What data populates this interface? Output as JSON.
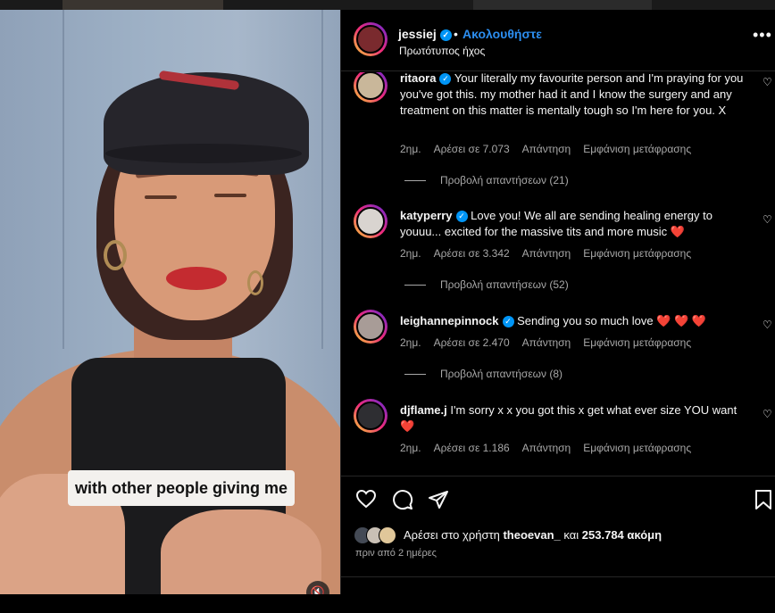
{
  "post": {
    "author": "jessiej",
    "dot": "•",
    "follow_label": "Ακολουθήστε",
    "audio": "Πρωτότυπος ήχος",
    "more_label": "•••"
  },
  "video": {
    "caption": "with other people giving me",
    "mute_icon": "🔇"
  },
  "comments": [
    {
      "user": "ritaora",
      "text": "Your literally my favourite person and I'm praying for you you've got this. my mother had it and I know the surgery and any treatment on this matter is mentally tough so I'm here for you. X",
      "time": "2ημ.",
      "likes": "Αρέσει σε 7.073",
      "reply": "Απάντηση",
      "translate": "Εμφάνιση μετάφρασης",
      "view_replies": "Προβολή απαντήσεων (21)"
    },
    {
      "user": "katyperry",
      "text": "Love you! We all are sending healing energy to youuu... excited for the massive tits and more music ",
      "emoji": "❤️",
      "time": "2ημ.",
      "likes": "Αρέσει σε 3.342",
      "reply": "Απάντηση",
      "translate": "Εμφάνιση μετάφρασης",
      "view_replies": "Προβολή απαντήσεων (52)"
    },
    {
      "user": "leighannepinnock",
      "text": "Sending you so much love ",
      "emoji": "❤️ ❤️ ❤️",
      "time": "2ημ.",
      "likes": "Αρέσει σε 2.470",
      "reply": "Απάντηση",
      "translate": "Εμφάνιση μετάφρασης",
      "view_replies": "Προβολή απαντήσεων (8)"
    },
    {
      "user": "djflame.j",
      "text": "I'm sorry x x you got this x get what ever size YOU want ",
      "emoji": "❤️",
      "time": "2ημ.",
      "likes": "Αρέσει σε 1.186",
      "reply": "Απάντηση",
      "translate": "Εμφάνιση μετάφρασης"
    }
  ],
  "footer": {
    "likes_prefix": "Αρέσει στο χρήστη",
    "liker": "theoevan_",
    "likes_mid": "και",
    "likes_count": "253.784 ακόμη",
    "posted": "πριν από 2 ημέρες"
  },
  "icons": {
    "heart": "heart-icon",
    "comment": "comment-icon",
    "share": "share-icon",
    "save": "bookmark-icon",
    "verified": "verified-badge-icon"
  },
  "colors": {
    "accent": "#0095f6",
    "follow": "#2c8ef0",
    "like_red": "#ff3040"
  }
}
